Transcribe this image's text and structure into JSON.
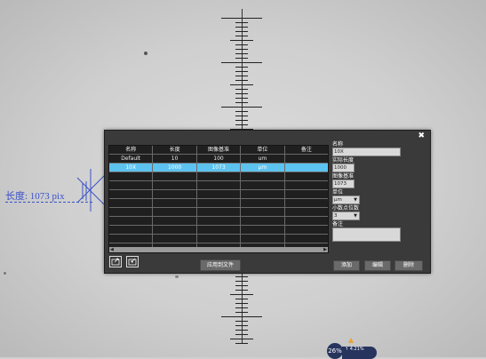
{
  "measurement": {
    "label": "长度: 1073 pix"
  },
  "dialog": {
    "columns": [
      "名称",
      "长度",
      "图像基准",
      "单位",
      "备注"
    ],
    "rows": [
      [
        "Default",
        "10",
        "100",
        "um",
        ""
      ],
      [
        "10X",
        "1000",
        "1073",
        "μm",
        ""
      ]
    ],
    "apply_label": "应用到文件",
    "form": {
      "name_label": "名称",
      "name_value": "10X",
      "length_label": "实际长度",
      "length_value": "1000",
      "base_label": "图像基准",
      "base_value": "1073",
      "unit_label": "单位",
      "unit_value": "μm",
      "decimals_label": "小数点位数",
      "decimals_value": "3",
      "note_label": "备注",
      "note_value": ""
    },
    "buttons": {
      "add": "添加",
      "edit": "编辑",
      "delete": "删除"
    }
  },
  "magnification": {
    "value": "26%",
    "info": "↑ 4.21%"
  }
}
